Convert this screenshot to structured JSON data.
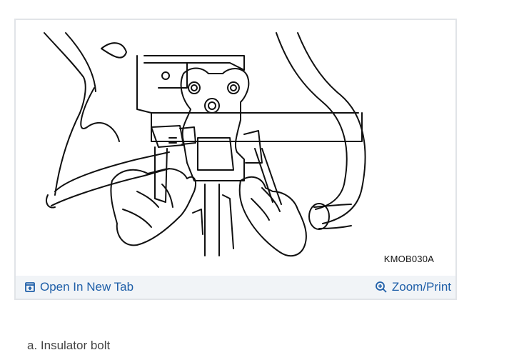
{
  "figure": {
    "code_label": "KMOB030A",
    "open_tab_label": "Open In New Tab",
    "zoom_print_label": "Zoom/Print",
    "open_tab_icon": "open-in-new-tab-icon",
    "zoom_icon": "zoom-in-icon"
  },
  "caption": {
    "text": "a. Insulator bolt"
  },
  "colors": {
    "link": "#1f5fa8",
    "footer_bg": "#f1f4f7",
    "border": "#e1e4e8"
  }
}
